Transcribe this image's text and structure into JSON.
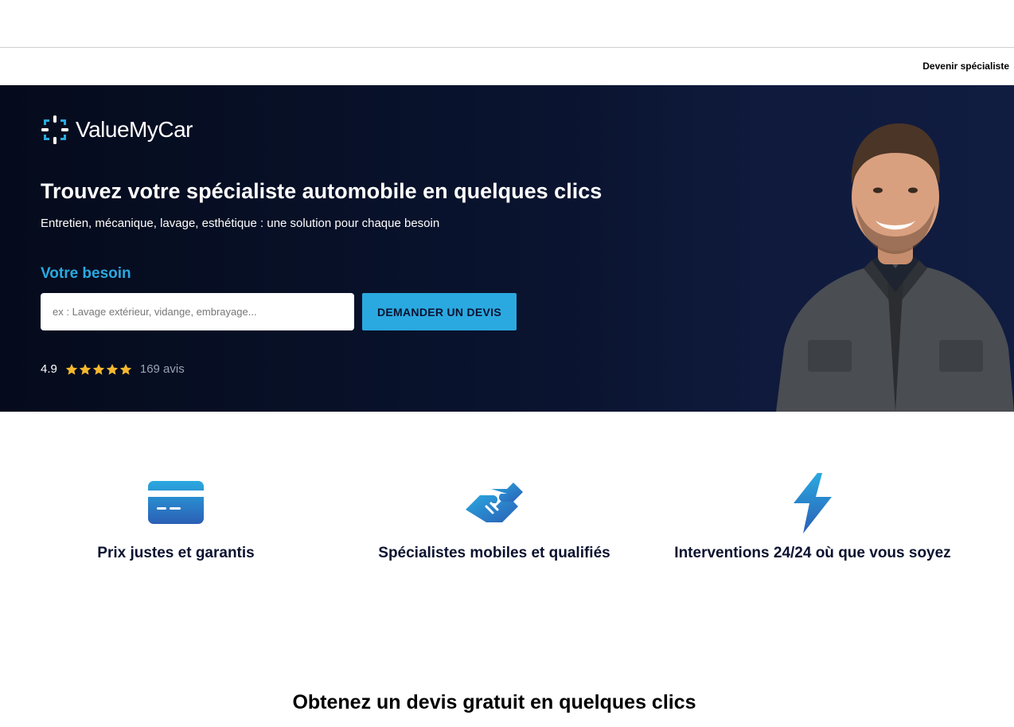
{
  "nav": {
    "become_specialist": "Devenir spécialiste"
  },
  "brand": {
    "name": "ValueMyCar",
    "accent": "#2aa9e0",
    "dark": "#0b1230"
  },
  "hero": {
    "title": "Trouvez votre spécialiste automobile en quelques clics",
    "subtitle": "Entretien, mécanique, lavage, esthétique : une solution pour chaque besoin",
    "need_label": "Votre besoin",
    "search_placeholder": "ex : Lavage extérieur, vidange, embrayage...",
    "search_value": "",
    "cta_label": "DEMANDER UN DEVIS",
    "rating": {
      "score": "4.9",
      "stars": 5,
      "count_label": "169 avis",
      "star_color": "#f5b82e"
    },
    "image_icon": "mechanic-portrait"
  },
  "features": [
    {
      "label": "Prix justes et garantis",
      "icon": "credit-card-icon"
    },
    {
      "label": "Spécialistes mobiles et qualifiés",
      "icon": "handshake-icon"
    },
    {
      "label": "Interventions 24/24 où que vous soyez",
      "icon": "lightning-icon"
    }
  ],
  "section": {
    "quote_title": "Obtenez un devis gratuit en quelques clics"
  }
}
